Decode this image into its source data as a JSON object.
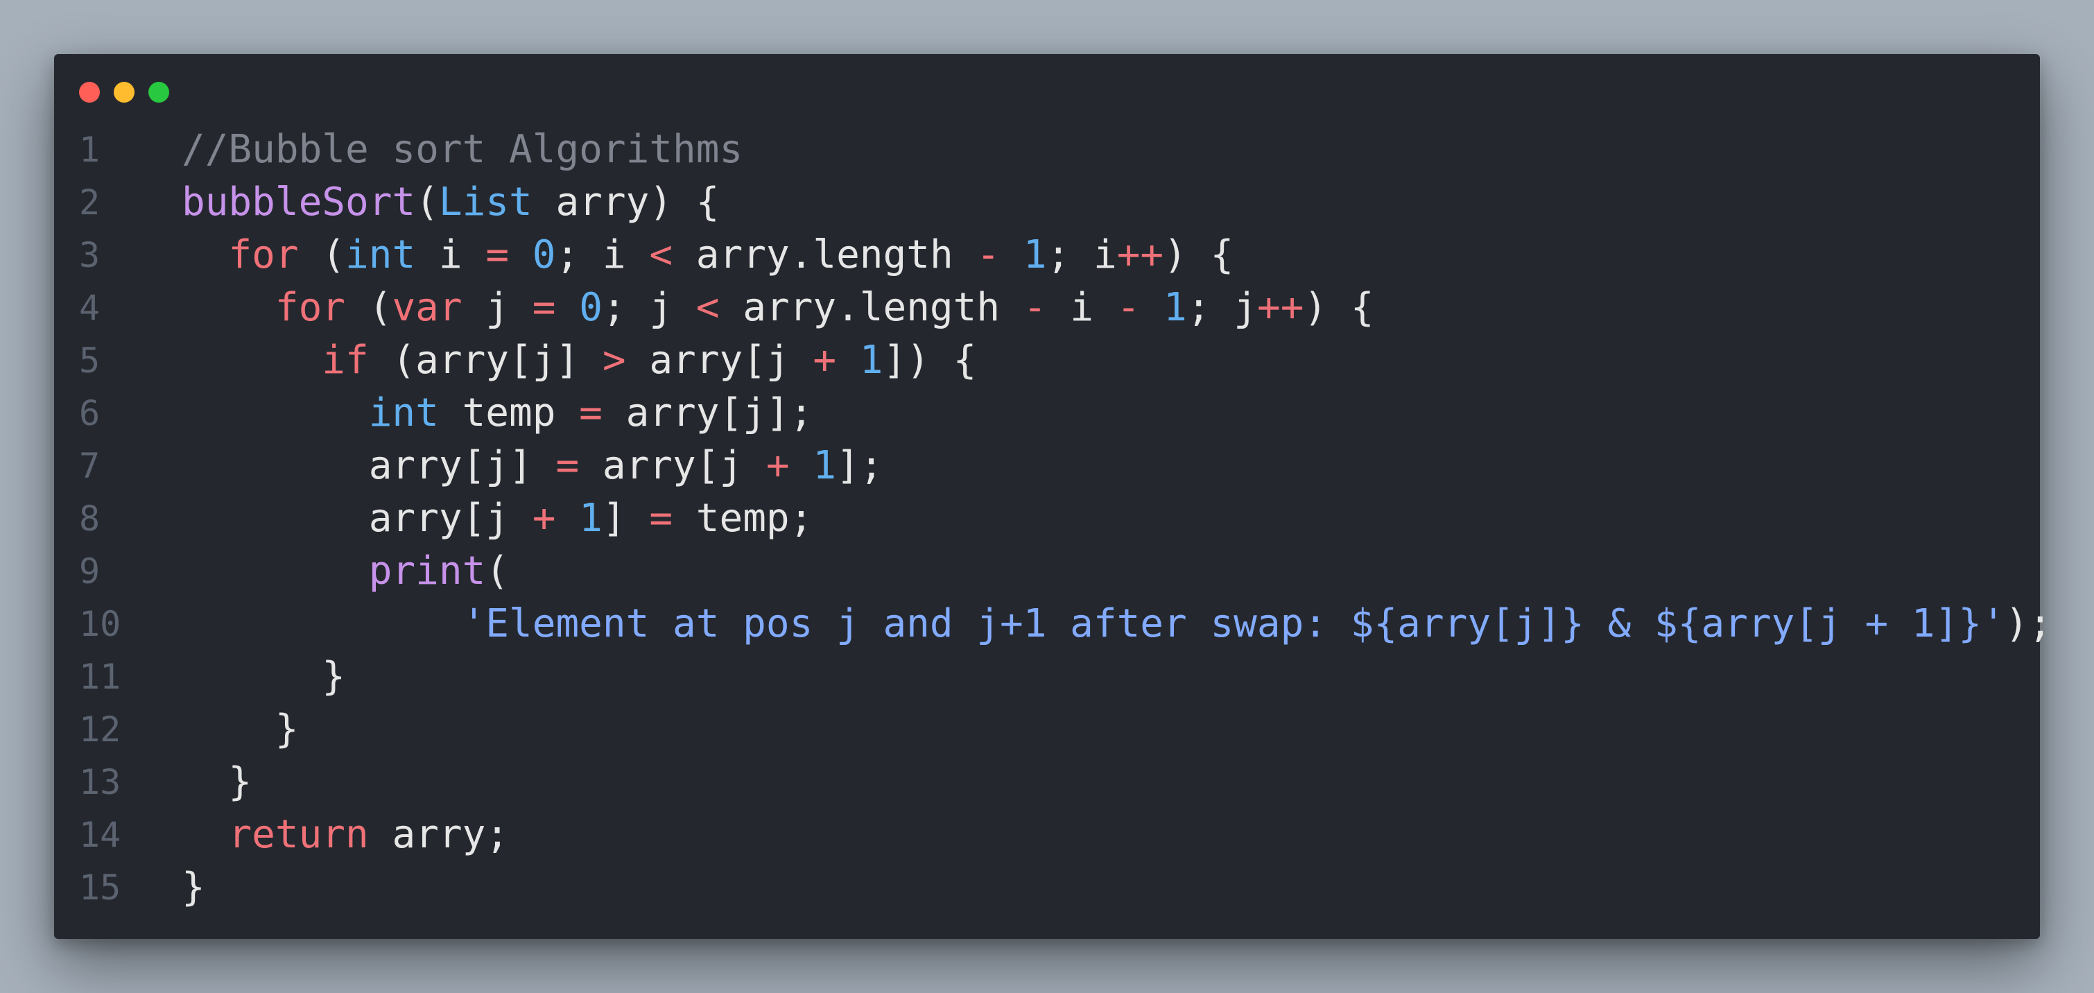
{
  "window": {
    "traffic_lights": [
      {
        "name": "close-dot",
        "color": "#ff5f57"
      },
      {
        "name": "minimize-dot",
        "color": "#febc2e"
      },
      {
        "name": "maximize-dot",
        "color": "#28c840"
      }
    ]
  },
  "colors": {
    "background": "#a6b0bb",
    "editor_bg": "#24282e",
    "line_number": "#5c6370",
    "comment": "#7f848e",
    "plain": "#e6e6e6",
    "keyword": "#f07178",
    "type": "#61afef",
    "number": "#61afef",
    "function": "#c792ea",
    "string": "#82aaff"
  },
  "editor": {
    "lines": [
      {
        "no": "1",
        "tokens": [
          {
            "t": "//Bubble sort Algorithms",
            "k": "comment"
          }
        ]
      },
      {
        "no": "2",
        "tokens": [
          {
            "t": "bubbleSort",
            "k": "function"
          },
          {
            "t": "(",
            "k": "plain"
          },
          {
            "t": "List",
            "k": "type"
          },
          {
            "t": " arry) {",
            "k": "plain"
          }
        ]
      },
      {
        "no": "3",
        "tokens": [
          {
            "t": "  ",
            "k": "plain"
          },
          {
            "t": "for",
            "k": "keyword"
          },
          {
            "t": " (",
            "k": "plain"
          },
          {
            "t": "int",
            "k": "type"
          },
          {
            "t": " i ",
            "k": "plain"
          },
          {
            "t": "=",
            "k": "keyword"
          },
          {
            "t": " ",
            "k": "plain"
          },
          {
            "t": "0",
            "k": "number"
          },
          {
            "t": "; i ",
            "k": "plain"
          },
          {
            "t": "<",
            "k": "keyword"
          },
          {
            "t": " arry.length ",
            "k": "plain"
          },
          {
            "t": "-",
            "k": "keyword"
          },
          {
            "t": " ",
            "k": "plain"
          },
          {
            "t": "1",
            "k": "number"
          },
          {
            "t": "; i",
            "k": "plain"
          },
          {
            "t": "++",
            "k": "keyword"
          },
          {
            "t": ") {",
            "k": "plain"
          }
        ]
      },
      {
        "no": "4",
        "tokens": [
          {
            "t": "    ",
            "k": "plain"
          },
          {
            "t": "for",
            "k": "keyword"
          },
          {
            "t": " (",
            "k": "plain"
          },
          {
            "t": "var",
            "k": "keyword"
          },
          {
            "t": " j ",
            "k": "plain"
          },
          {
            "t": "=",
            "k": "keyword"
          },
          {
            "t": " ",
            "k": "plain"
          },
          {
            "t": "0",
            "k": "number"
          },
          {
            "t": "; j ",
            "k": "plain"
          },
          {
            "t": "<",
            "k": "keyword"
          },
          {
            "t": " arry.length ",
            "k": "plain"
          },
          {
            "t": "-",
            "k": "keyword"
          },
          {
            "t": " i ",
            "k": "plain"
          },
          {
            "t": "-",
            "k": "keyword"
          },
          {
            "t": " ",
            "k": "plain"
          },
          {
            "t": "1",
            "k": "number"
          },
          {
            "t": "; j",
            "k": "plain"
          },
          {
            "t": "++",
            "k": "keyword"
          },
          {
            "t": ") {",
            "k": "plain"
          }
        ]
      },
      {
        "no": "5",
        "tokens": [
          {
            "t": "      ",
            "k": "plain"
          },
          {
            "t": "if",
            "k": "keyword"
          },
          {
            "t": " (arry[j] ",
            "k": "plain"
          },
          {
            "t": ">",
            "k": "keyword"
          },
          {
            "t": " arry[j ",
            "k": "plain"
          },
          {
            "t": "+",
            "k": "keyword"
          },
          {
            "t": " ",
            "k": "plain"
          },
          {
            "t": "1",
            "k": "number"
          },
          {
            "t": "]) {",
            "k": "plain"
          }
        ]
      },
      {
        "no": "6",
        "tokens": [
          {
            "t": "        ",
            "k": "plain"
          },
          {
            "t": "int",
            "k": "type"
          },
          {
            "t": " temp ",
            "k": "plain"
          },
          {
            "t": "=",
            "k": "keyword"
          },
          {
            "t": " arry[j];",
            "k": "plain"
          }
        ]
      },
      {
        "no": "7",
        "tokens": [
          {
            "t": "        arry[j] ",
            "k": "plain"
          },
          {
            "t": "=",
            "k": "keyword"
          },
          {
            "t": " arry[j ",
            "k": "plain"
          },
          {
            "t": "+",
            "k": "keyword"
          },
          {
            "t": " ",
            "k": "plain"
          },
          {
            "t": "1",
            "k": "number"
          },
          {
            "t": "];",
            "k": "plain"
          }
        ]
      },
      {
        "no": "8",
        "tokens": [
          {
            "t": "        arry[j ",
            "k": "plain"
          },
          {
            "t": "+",
            "k": "keyword"
          },
          {
            "t": " ",
            "k": "plain"
          },
          {
            "t": "1",
            "k": "number"
          },
          {
            "t": "] ",
            "k": "plain"
          },
          {
            "t": "=",
            "k": "keyword"
          },
          {
            "t": " temp;",
            "k": "plain"
          }
        ]
      },
      {
        "no": "9",
        "tokens": [
          {
            "t": "        ",
            "k": "plain"
          },
          {
            "t": "print",
            "k": "function"
          },
          {
            "t": "(",
            "k": "plain"
          }
        ]
      },
      {
        "no": "10",
        "tokens": [
          {
            "t": "            ",
            "k": "plain"
          },
          {
            "t": "'Element at pos j and j+1 after swap: ${arry[j]} & ${arry[j + 1]}'",
            "k": "string"
          },
          {
            "t": ");",
            "k": "plain"
          }
        ]
      },
      {
        "no": "11",
        "tokens": [
          {
            "t": "      }",
            "k": "plain"
          }
        ]
      },
      {
        "no": "12",
        "tokens": [
          {
            "t": "    }",
            "k": "plain"
          }
        ]
      },
      {
        "no": "13",
        "tokens": [
          {
            "t": "  }",
            "k": "plain"
          }
        ]
      },
      {
        "no": "14",
        "tokens": [
          {
            "t": "  ",
            "k": "plain"
          },
          {
            "t": "return",
            "k": "keyword"
          },
          {
            "t": " arry;",
            "k": "plain"
          }
        ]
      },
      {
        "no": "15",
        "tokens": [
          {
            "t": "}",
            "k": "plain"
          }
        ]
      }
    ]
  }
}
